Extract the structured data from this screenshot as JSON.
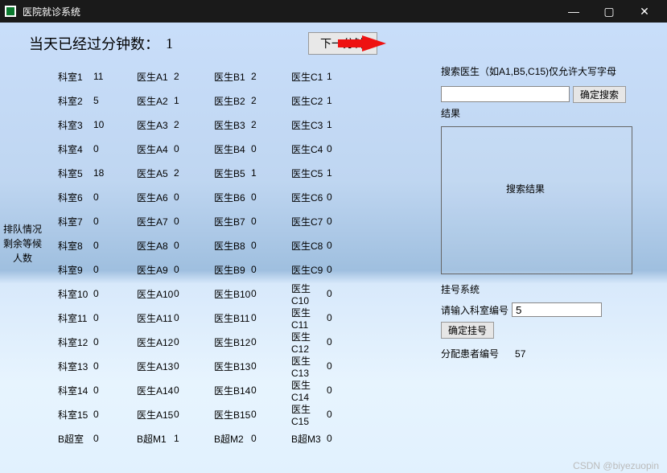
{
  "window": {
    "title": "医院就诊系统"
  },
  "top": {
    "minutes_label": "当天已经过分钟数：",
    "minutes_value": "1",
    "next_button": "下一分钟"
  },
  "sidelabel": {
    "line1": "排队情况",
    "line2": "剩余等候人数"
  },
  "rows": [
    {
      "k": "科室1",
      "v": "11",
      "a": "医生A1",
      "av": "2",
      "b": "医生B1",
      "bv": "2",
      "c": "医生C1",
      "cv": "1"
    },
    {
      "k": "科室2",
      "v": "5",
      "a": "医生A2",
      "av": "1",
      "b": "医生B2",
      "bv": "2",
      "c": "医生C2",
      "cv": "1"
    },
    {
      "k": "科室3",
      "v": "10",
      "a": "医生A3",
      "av": "2",
      "b": "医生B3",
      "bv": "2",
      "c": "医生C3",
      "cv": "1"
    },
    {
      "k": "科室4",
      "v": "0",
      "a": "医生A4",
      "av": "0",
      "b": "医生B4",
      "bv": "0",
      "c": "医生C4",
      "cv": "0"
    },
    {
      "k": "科室5",
      "v": "18",
      "a": "医生A5",
      "av": "2",
      "b": "医生B5",
      "bv": "1",
      "c": "医生C5",
      "cv": "1"
    },
    {
      "k": "科室6",
      "v": "0",
      "a": "医生A6",
      "av": "0",
      "b": "医生B6",
      "bv": "0",
      "c": "医生C6",
      "cv": "0"
    },
    {
      "k": "科室7",
      "v": "0",
      "a": "医生A7",
      "av": "0",
      "b": "医生B7",
      "bv": "0",
      "c": "医生C7",
      "cv": "0"
    },
    {
      "k": "科室8",
      "v": "0",
      "a": "医生A8",
      "av": "0",
      "b": "医生B8",
      "bv": "0",
      "c": "医生C8",
      "cv": "0"
    },
    {
      "k": "科室9",
      "v": "0",
      "a": "医生A9",
      "av": "0",
      "b": "医生B9",
      "bv": "0",
      "c": "医生C9",
      "cv": "0"
    },
    {
      "k": "科室10",
      "v": "0",
      "a": "医生A10",
      "av": "0",
      "b": "医生B10",
      "bv": "0",
      "c": "医生C10",
      "cv": "0"
    },
    {
      "k": "科室11",
      "v": "0",
      "a": "医生A11",
      "av": "0",
      "b": "医生B11",
      "bv": "0",
      "c": "医生C11",
      "cv": "0"
    },
    {
      "k": "科室12",
      "v": "0",
      "a": "医生A12",
      "av": "0",
      "b": "医生B12",
      "bv": "0",
      "c": "医生C12",
      "cv": "0"
    },
    {
      "k": "科室13",
      "v": "0",
      "a": "医生A13",
      "av": "0",
      "b": "医生B13",
      "bv": "0",
      "c": "医生C13",
      "cv": "0"
    },
    {
      "k": "科室14",
      "v": "0",
      "a": "医生A14",
      "av": "0",
      "b": "医生B14",
      "bv": "0",
      "c": "医生C14",
      "cv": "0"
    },
    {
      "k": "科室15",
      "v": "0",
      "a": "医生A15",
      "av": "0",
      "b": "医生B15",
      "bv": "0",
      "c": "医生C15",
      "cv": "0"
    },
    {
      "k": "B超室",
      "v": "0",
      "a": "B超M1",
      "av": "1",
      "b": "B超M2",
      "bv": "0",
      "c": "B超M3",
      "cv": "0"
    }
  ],
  "search": {
    "hint": "搜索医生（如A1,B5,C15)仅允许大写字母",
    "button": "确定搜索",
    "result_label": "结果",
    "result_placeholder": "搜索结果"
  },
  "register": {
    "section_label": "挂号系统",
    "input_label": "请输入科室编号",
    "input_value": "5",
    "button": "确定挂号",
    "assigned_label": "分配患者编号",
    "assigned_value": "57"
  },
  "watermark": "CSDN @biyezuopin"
}
